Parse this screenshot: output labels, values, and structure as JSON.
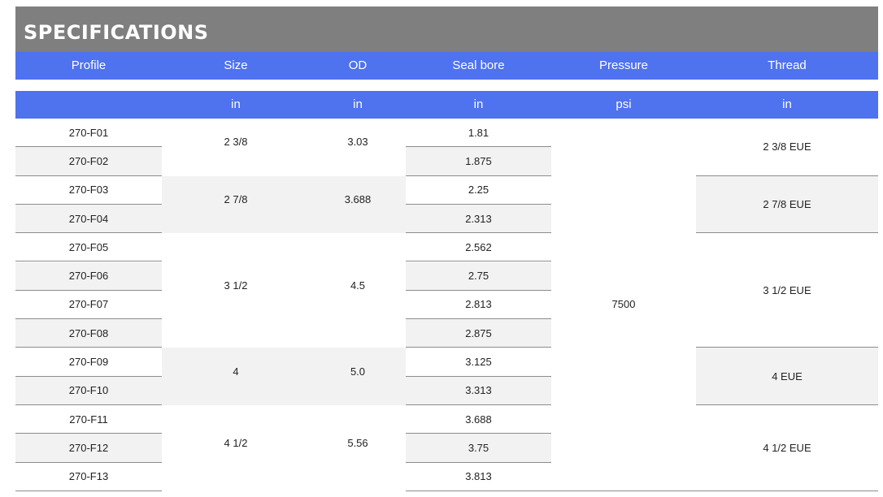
{
  "title": "SPECIFICATIONS",
  "columns": [
    {
      "label": "Profile",
      "unit": ""
    },
    {
      "label": "Size",
      "unit": "in"
    },
    {
      "label": "OD",
      "unit": "in"
    },
    {
      "label": "Seal bore",
      "unit": "in"
    },
    {
      "label": "Pressure",
      "unit": "psi"
    },
    {
      "label": "Thread",
      "unit": "in"
    }
  ],
  "profiles": [
    "270-F01",
    "270-F02",
    "270-F03",
    "270-F04",
    "270-F05",
    "270-F06",
    "270-F07",
    "270-F08",
    "270-F09",
    "270-F10",
    "270-F11",
    "270-F12",
    "270-F13"
  ],
  "seal_bores": [
    "1.81",
    "1.875",
    "2.25",
    "2.313",
    "2.562",
    "2.75",
    "2.813",
    "2.875",
    "3.125",
    "3.313",
    "3.688",
    "3.75",
    "3.813"
  ],
  "groups": [
    {
      "size": "2 3/8",
      "od": "3.03",
      "thread": "2 3/8 EUE"
    },
    {
      "size": "2 7/8",
      "od": "3.688",
      "thread": "2 7/8 EUE"
    },
    {
      "size": "3 1/2",
      "od": "4.5",
      "thread": "3 1/2 EUE"
    },
    {
      "size": "4",
      "od": "5.0",
      "thread": "4 EUE"
    },
    {
      "size": "4 1/2",
      "od": "5.56",
      "thread": "4 1/2 EUE"
    }
  ],
  "pressure": "7500"
}
